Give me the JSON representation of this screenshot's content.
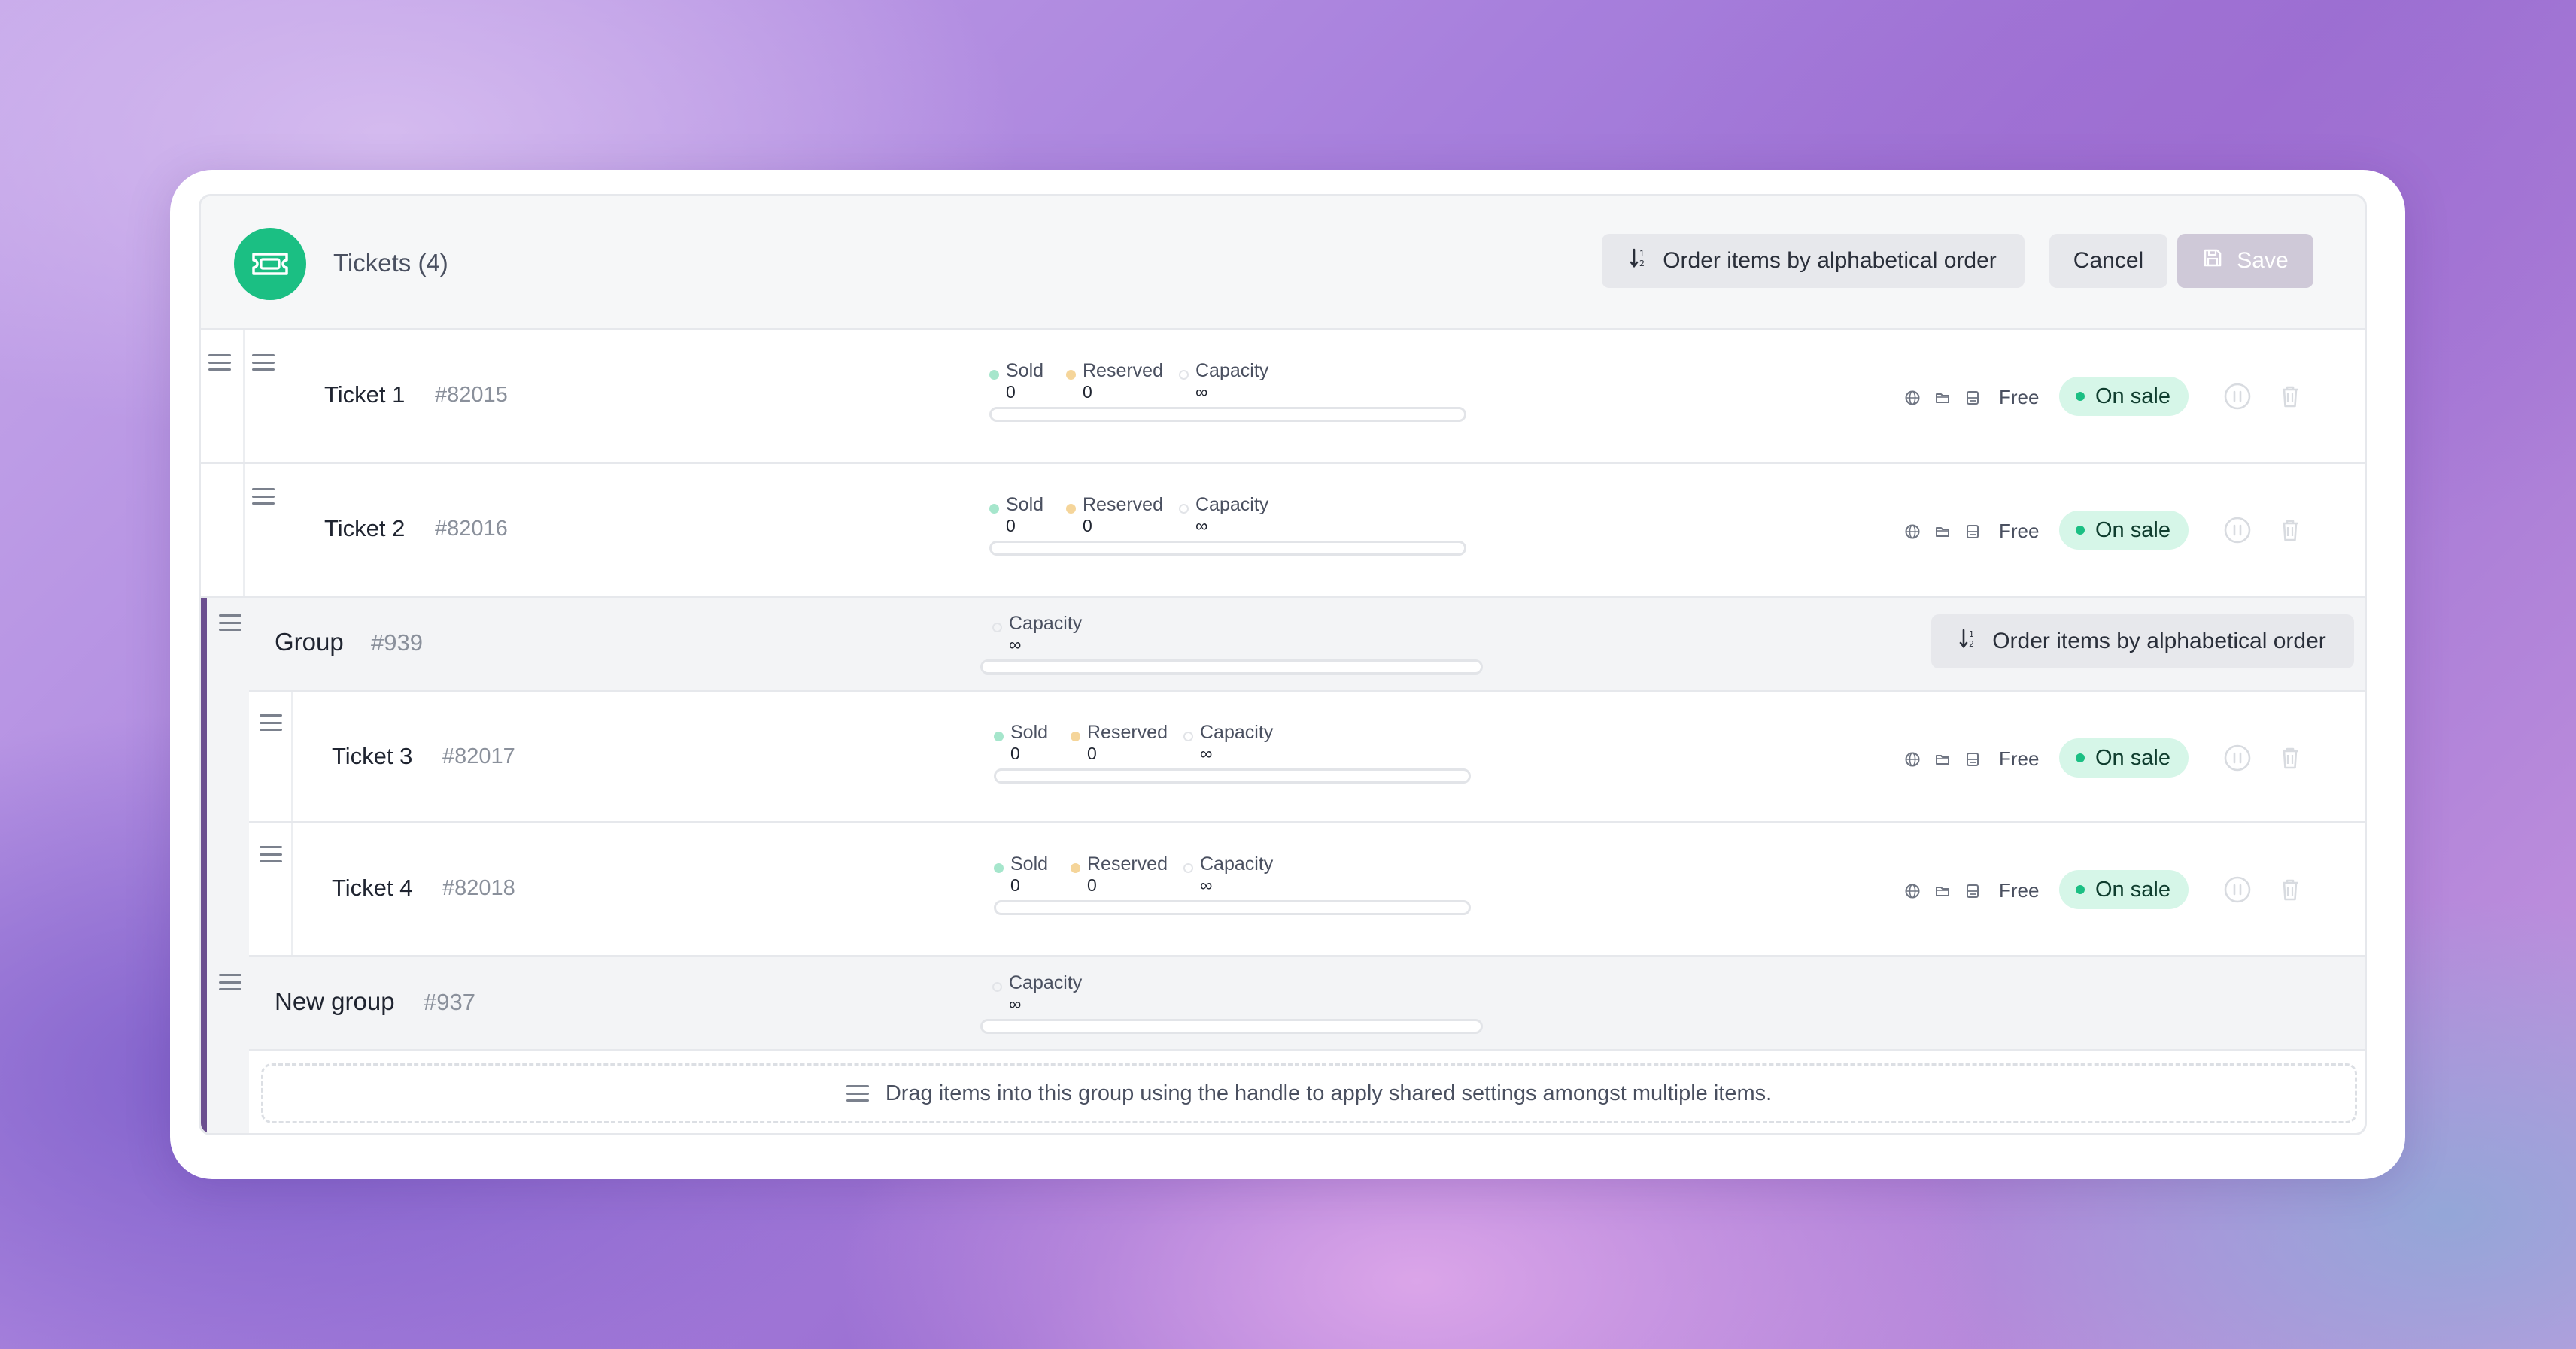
{
  "header": {
    "title": "Tickets (4)",
    "order_label": "Order items by alphabetical order",
    "cancel_label": "Cancel",
    "save_label": "Save"
  },
  "tickets": [
    {
      "name": "Ticket 1",
      "id": "#82015",
      "sold_label": "Sold",
      "sold": "0",
      "reserved_label": "Reserved",
      "reserved": "0",
      "capacity_label": "Capacity",
      "capacity": "∞",
      "price": "Free",
      "status": "On sale"
    },
    {
      "name": "Ticket 2",
      "id": "#82016",
      "sold_label": "Sold",
      "sold": "0",
      "reserved_label": "Reserved",
      "reserved": "0",
      "capacity_label": "Capacity",
      "capacity": "∞",
      "price": "Free",
      "status": "On sale"
    },
    {
      "name": "Ticket 3",
      "id": "#82017",
      "sold_label": "Sold",
      "sold": "0",
      "reserved_label": "Reserved",
      "reserved": "0",
      "capacity_label": "Capacity",
      "capacity": "∞",
      "price": "Free",
      "status": "On sale"
    },
    {
      "name": "Ticket 4",
      "id": "#82018",
      "sold_label": "Sold",
      "sold": "0",
      "reserved_label": "Reserved",
      "reserved": "0",
      "capacity_label": "Capacity",
      "capacity": "∞",
      "price": "Free",
      "status": "On sale"
    }
  ],
  "groups": [
    {
      "name": "Group",
      "id": "#939",
      "capacity_label": "Capacity",
      "capacity": "∞",
      "order_label": "Order items by alphabetical order"
    },
    {
      "name": "New group",
      "id": "#937",
      "capacity_label": "Capacity",
      "capacity": "∞",
      "dropzone_text": "Drag items into this group using the handle to apply shared settings amongst multiple items."
    }
  ],
  "colors": {
    "brand": "#1bbf83",
    "group_accent": "#6b4f8f",
    "status_badge_bg": "#d6f6e8"
  },
  "icons": {
    "logo": "ticket-icon",
    "order": "sort-alpha-icon",
    "save": "floppy-disk-icon",
    "drag": "drag-handle-icon",
    "visibility": "globe-icon",
    "folder": "folder-icon",
    "seat": "seat-icon",
    "pause": "pause-circle-icon",
    "delete": "trash-icon"
  }
}
